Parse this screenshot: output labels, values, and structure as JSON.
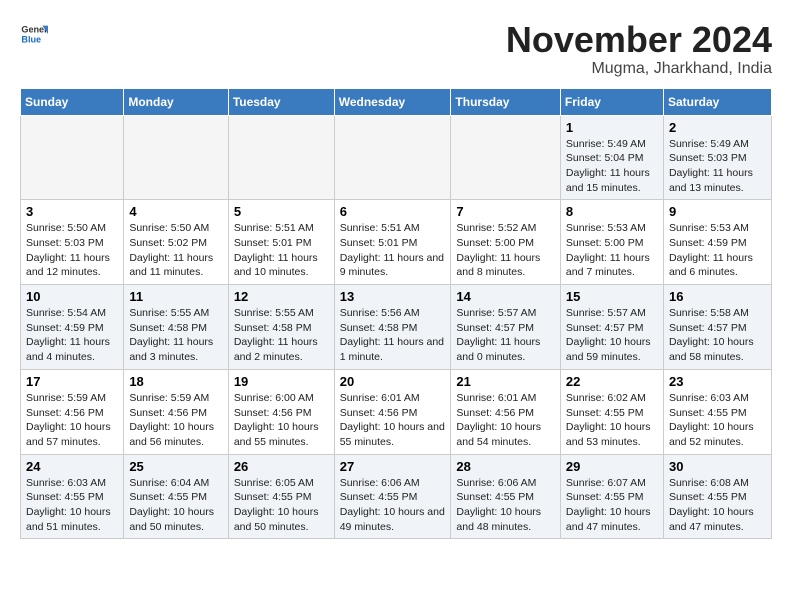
{
  "logo": {
    "general": "General",
    "blue": "Blue"
  },
  "title": "November 2024",
  "location": "Mugma, Jharkhand, India",
  "weekdays": [
    "Sunday",
    "Monday",
    "Tuesday",
    "Wednesday",
    "Thursday",
    "Friday",
    "Saturday"
  ],
  "weeks": [
    [
      {
        "day": "",
        "info": ""
      },
      {
        "day": "",
        "info": ""
      },
      {
        "day": "",
        "info": ""
      },
      {
        "day": "",
        "info": ""
      },
      {
        "day": "",
        "info": ""
      },
      {
        "day": "1",
        "info": "Sunrise: 5:49 AM\nSunset: 5:04 PM\nDaylight: 11 hours and 15 minutes."
      },
      {
        "day": "2",
        "info": "Sunrise: 5:49 AM\nSunset: 5:03 PM\nDaylight: 11 hours and 13 minutes."
      }
    ],
    [
      {
        "day": "3",
        "info": "Sunrise: 5:50 AM\nSunset: 5:03 PM\nDaylight: 11 hours and 12 minutes."
      },
      {
        "day": "4",
        "info": "Sunrise: 5:50 AM\nSunset: 5:02 PM\nDaylight: 11 hours and 11 minutes."
      },
      {
        "day": "5",
        "info": "Sunrise: 5:51 AM\nSunset: 5:01 PM\nDaylight: 11 hours and 10 minutes."
      },
      {
        "day": "6",
        "info": "Sunrise: 5:51 AM\nSunset: 5:01 PM\nDaylight: 11 hours and 9 minutes."
      },
      {
        "day": "7",
        "info": "Sunrise: 5:52 AM\nSunset: 5:00 PM\nDaylight: 11 hours and 8 minutes."
      },
      {
        "day": "8",
        "info": "Sunrise: 5:53 AM\nSunset: 5:00 PM\nDaylight: 11 hours and 7 minutes."
      },
      {
        "day": "9",
        "info": "Sunrise: 5:53 AM\nSunset: 4:59 PM\nDaylight: 11 hours and 6 minutes."
      }
    ],
    [
      {
        "day": "10",
        "info": "Sunrise: 5:54 AM\nSunset: 4:59 PM\nDaylight: 11 hours and 4 minutes."
      },
      {
        "day": "11",
        "info": "Sunrise: 5:55 AM\nSunset: 4:58 PM\nDaylight: 11 hours and 3 minutes."
      },
      {
        "day": "12",
        "info": "Sunrise: 5:55 AM\nSunset: 4:58 PM\nDaylight: 11 hours and 2 minutes."
      },
      {
        "day": "13",
        "info": "Sunrise: 5:56 AM\nSunset: 4:58 PM\nDaylight: 11 hours and 1 minute."
      },
      {
        "day": "14",
        "info": "Sunrise: 5:57 AM\nSunset: 4:57 PM\nDaylight: 11 hours and 0 minutes."
      },
      {
        "day": "15",
        "info": "Sunrise: 5:57 AM\nSunset: 4:57 PM\nDaylight: 10 hours and 59 minutes."
      },
      {
        "day": "16",
        "info": "Sunrise: 5:58 AM\nSunset: 4:57 PM\nDaylight: 10 hours and 58 minutes."
      }
    ],
    [
      {
        "day": "17",
        "info": "Sunrise: 5:59 AM\nSunset: 4:56 PM\nDaylight: 10 hours and 57 minutes."
      },
      {
        "day": "18",
        "info": "Sunrise: 5:59 AM\nSunset: 4:56 PM\nDaylight: 10 hours and 56 minutes."
      },
      {
        "day": "19",
        "info": "Sunrise: 6:00 AM\nSunset: 4:56 PM\nDaylight: 10 hours and 55 minutes."
      },
      {
        "day": "20",
        "info": "Sunrise: 6:01 AM\nSunset: 4:56 PM\nDaylight: 10 hours and 55 minutes."
      },
      {
        "day": "21",
        "info": "Sunrise: 6:01 AM\nSunset: 4:56 PM\nDaylight: 10 hours and 54 minutes."
      },
      {
        "day": "22",
        "info": "Sunrise: 6:02 AM\nSunset: 4:55 PM\nDaylight: 10 hours and 53 minutes."
      },
      {
        "day": "23",
        "info": "Sunrise: 6:03 AM\nSunset: 4:55 PM\nDaylight: 10 hours and 52 minutes."
      }
    ],
    [
      {
        "day": "24",
        "info": "Sunrise: 6:03 AM\nSunset: 4:55 PM\nDaylight: 10 hours and 51 minutes."
      },
      {
        "day": "25",
        "info": "Sunrise: 6:04 AM\nSunset: 4:55 PM\nDaylight: 10 hours and 50 minutes."
      },
      {
        "day": "26",
        "info": "Sunrise: 6:05 AM\nSunset: 4:55 PM\nDaylight: 10 hours and 50 minutes."
      },
      {
        "day": "27",
        "info": "Sunrise: 6:06 AM\nSunset: 4:55 PM\nDaylight: 10 hours and 49 minutes."
      },
      {
        "day": "28",
        "info": "Sunrise: 6:06 AM\nSunset: 4:55 PM\nDaylight: 10 hours and 48 minutes."
      },
      {
        "day": "29",
        "info": "Sunrise: 6:07 AM\nSunset: 4:55 PM\nDaylight: 10 hours and 47 minutes."
      },
      {
        "day": "30",
        "info": "Sunrise: 6:08 AM\nSunset: 4:55 PM\nDaylight: 10 hours and 47 minutes."
      }
    ]
  ]
}
